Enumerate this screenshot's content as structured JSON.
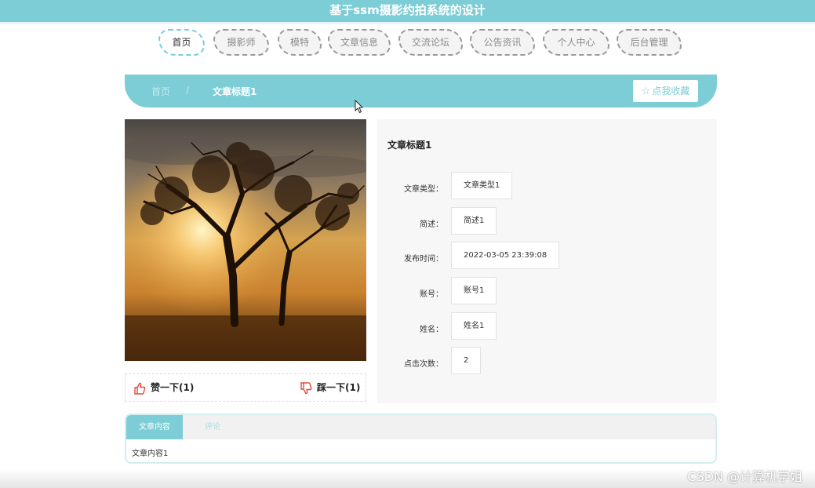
{
  "header": {
    "title": "基于ssm摄影约拍系统的设计"
  },
  "nav": {
    "items": [
      {
        "label": "首页",
        "active": true
      },
      {
        "label": "摄影师"
      },
      {
        "label": "模特"
      },
      {
        "label": "文章信息"
      },
      {
        "label": "交流论坛"
      },
      {
        "label": "公告资讯"
      },
      {
        "label": "个人中心"
      },
      {
        "label": "后台管理"
      }
    ]
  },
  "breadcrumb": {
    "home": "首页",
    "separator": "/",
    "current": "文章标题1"
  },
  "favorite": {
    "icon": "star-outline-icon",
    "label": "点我收藏"
  },
  "article": {
    "title": "文章标题1",
    "fields": [
      {
        "label": "文章类型：",
        "value": "文章类型1"
      },
      {
        "label": "简述：",
        "value": "简述1"
      },
      {
        "label": "发布时间：",
        "value": "2022-03-05 23:39:08"
      },
      {
        "label": "账号：",
        "value": "账号1"
      },
      {
        "label": "姓名：",
        "value": "姓名1"
      },
      {
        "label": "点击次数：",
        "value": "2"
      }
    ]
  },
  "votes": {
    "up_label": "赞一下(1)",
    "down_label": "踩一下(1)",
    "up_icon": "thumbs-up-icon",
    "down_icon": "thumbs-down-icon"
  },
  "tabs": {
    "items": [
      {
        "label": "文章内容"
      },
      {
        "label": "评论"
      }
    ],
    "content": "文章内容1"
  },
  "watermark": "CSDN @计算机学姐",
  "colors": {
    "accent": "#7ccdd6",
    "vote_icon": "#e04a3a"
  }
}
